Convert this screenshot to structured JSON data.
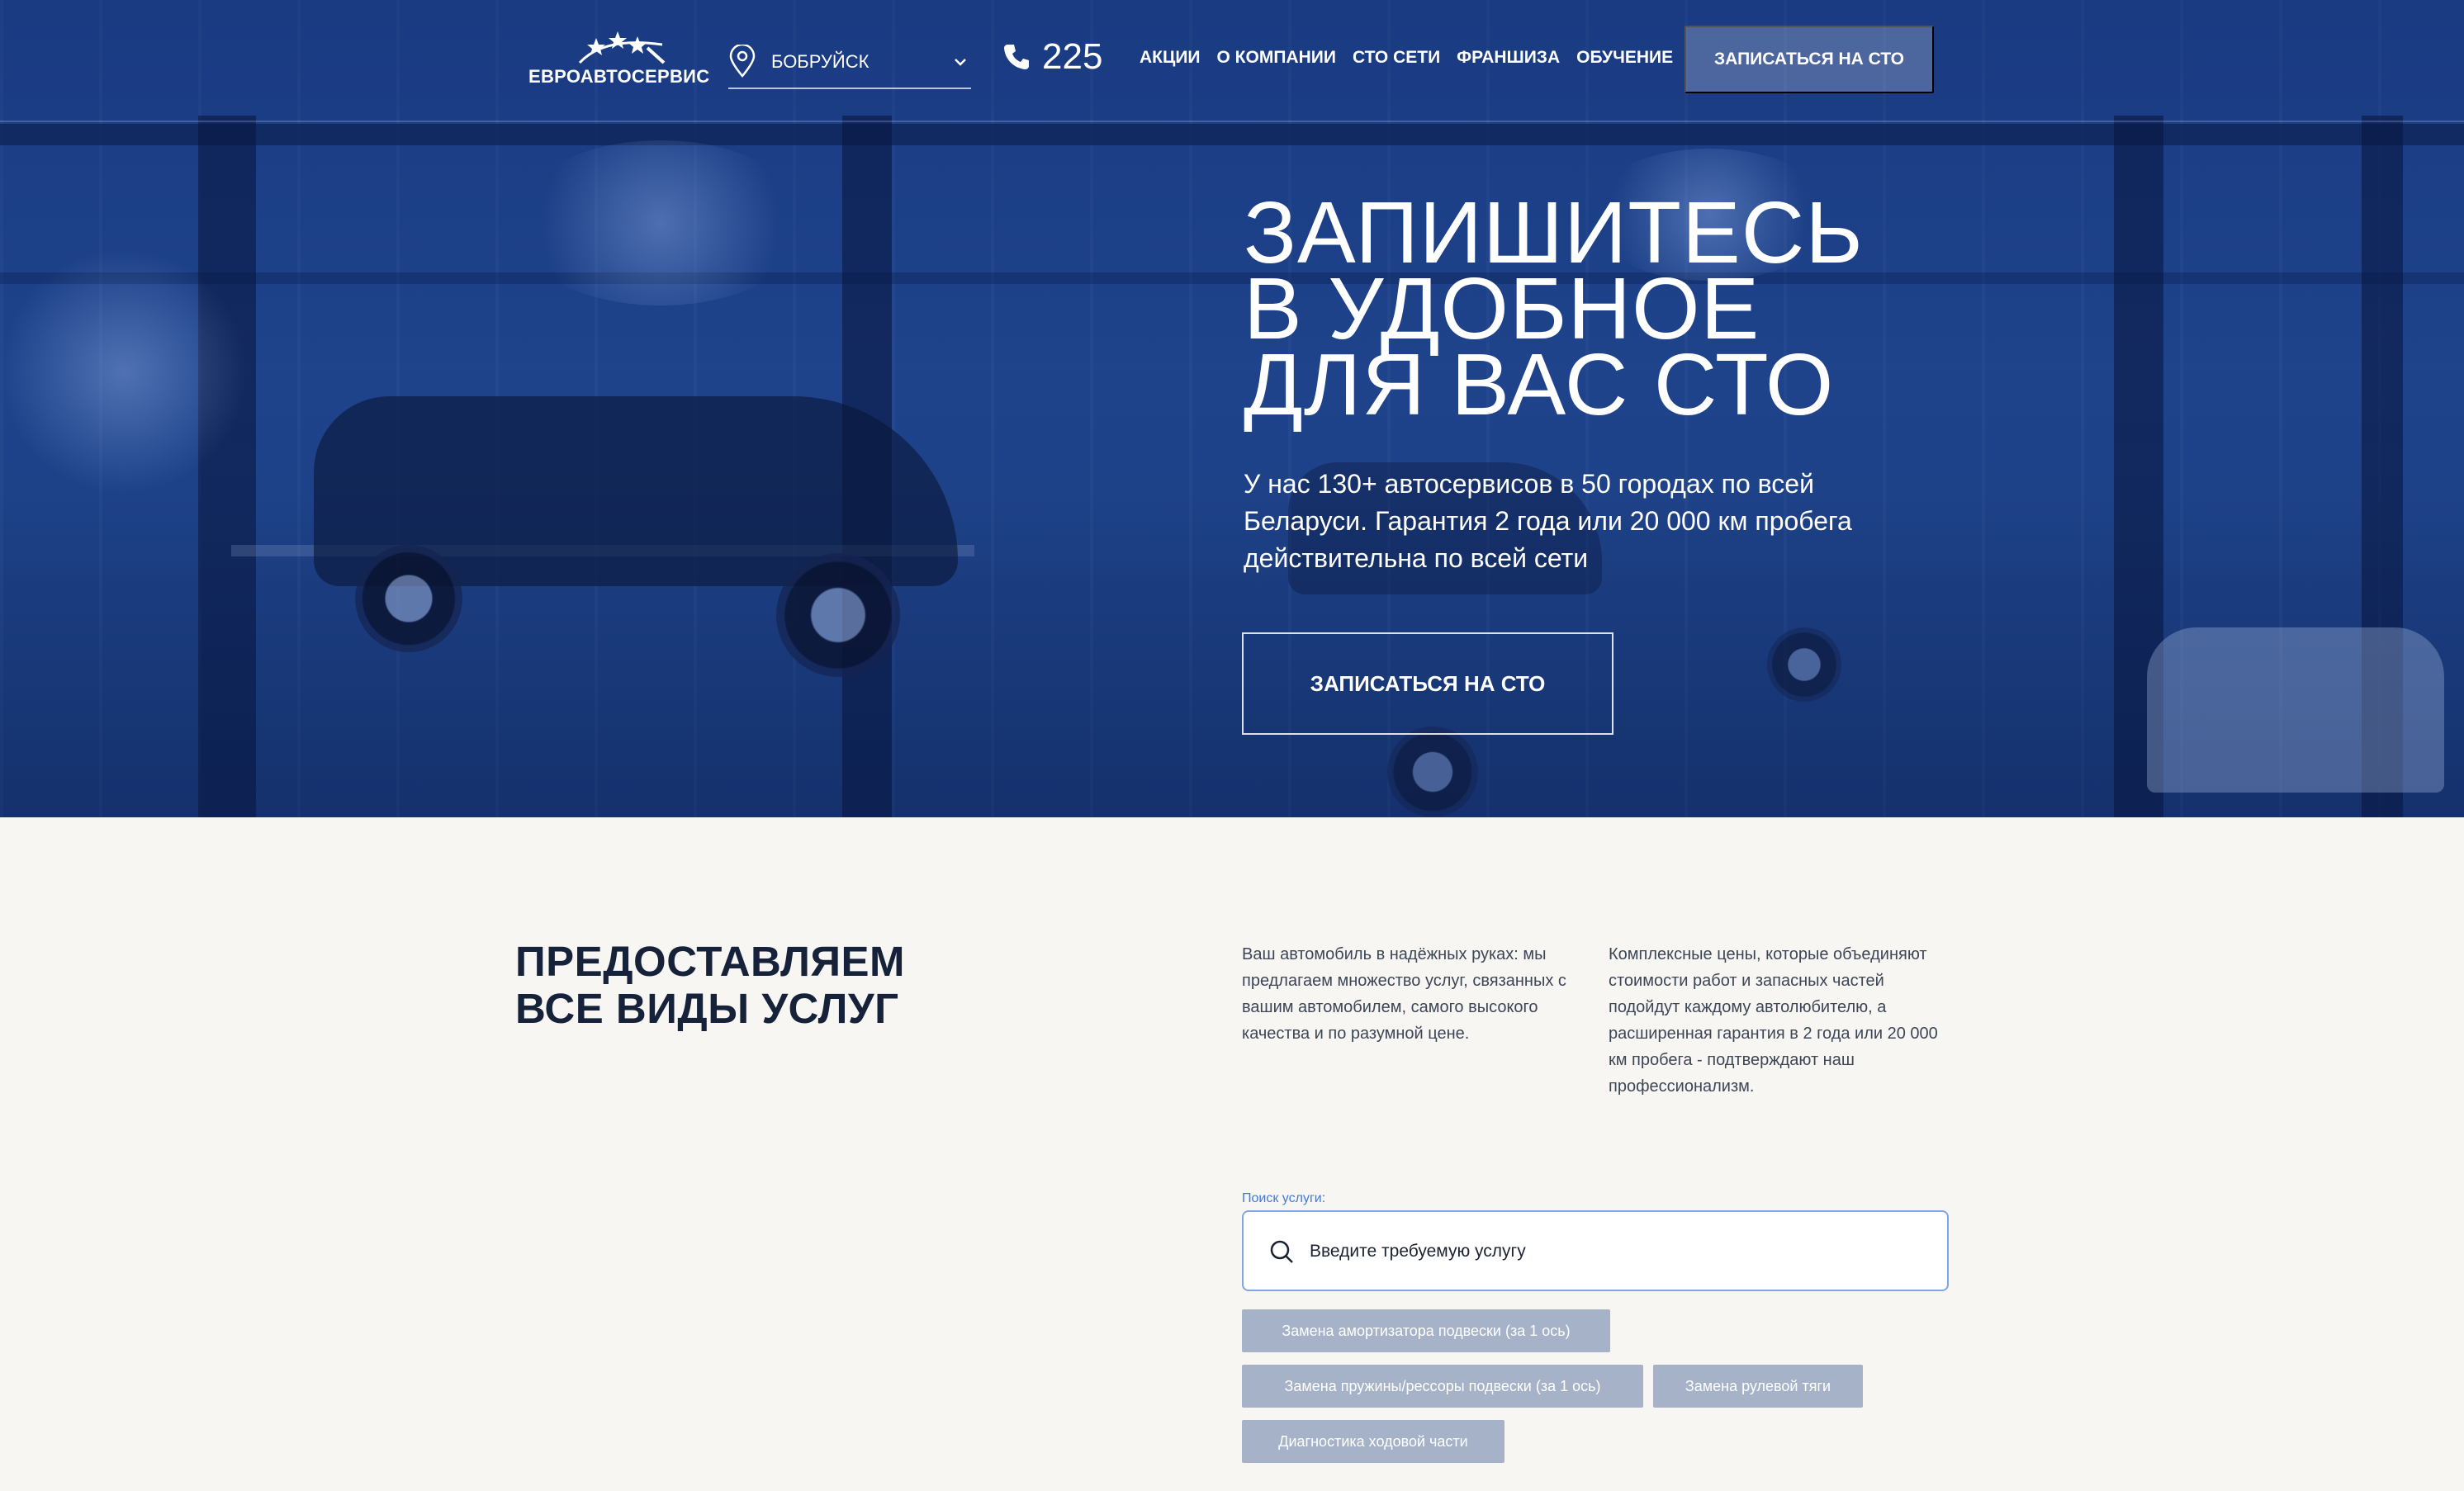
{
  "brand": {
    "logo_text": "ЕВРОАВТОСЕРВИС"
  },
  "header": {
    "city": "БОБРУЙСК",
    "phone": "225",
    "nav": [
      "АКЦИИ",
      "О КОМПАНИИ",
      "СТО СЕТИ",
      "ФРАНШИЗА",
      "ОБУЧЕНИЕ"
    ],
    "cta": "ЗАПИСАТЬСЯ НА СТО"
  },
  "hero": {
    "title_lines": [
      "ЗАПИШИТЕСЬ",
      "В УДОБНОЕ",
      "ДЛЯ ВАС СТО"
    ],
    "subtitle": "У нас 130+ автосервисов в 50 городах по всей Беларуси. Гарантия 2 года или 20 000 км пробега действительна по всей сети",
    "cta": "ЗАПИСАТЬСЯ НА СТО"
  },
  "services": {
    "title_lines": [
      "ПРЕДОСТАВЛЯЕМ",
      "ВСЕ ВИДЫ УСЛУГ"
    ],
    "text_1": "Ваш автомобиль в надёжных руках: мы предлагаем множество услуг, связанных с вашим автомобилем, самого высокого качества и по разумной цене.",
    "text_2": "Комплексные цены, которые объединяют стоимости работ и запасных частей подойдут каждому автолюбителю, а расширенная гарантия в 2 года или 20 000 км пробега - подтверждают наш профессионализм.",
    "search": {
      "label": "Поиск услуги:",
      "placeholder": "Введите требуемую услугу"
    },
    "chips": [
      "Замена амортизатора подвески (за 1 ось)",
      "Замена пружины/рессоры подвески (за 1 ось)",
      "Замена рулевой тяги",
      "Диагностика ходовой части"
    ]
  },
  "colors": {
    "hero_blue": "#21478f",
    "accent_blue": "#3f7bd9",
    "chip_gray": "#a5b2c8",
    "dark_text": "#15223a",
    "page_bg": "#f7f6f3"
  },
  "icons": {
    "location": "map-pin-icon",
    "dropdown": "chevron-down-icon",
    "phone": "phone-icon",
    "search": "search-icon",
    "logo": "stars-logo-icon"
  }
}
